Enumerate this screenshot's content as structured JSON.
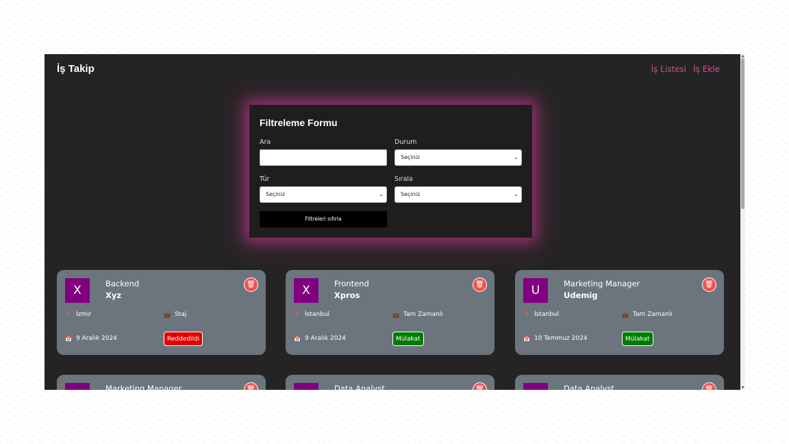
{
  "app": {
    "brand": "İş Takip"
  },
  "nav": {
    "items": [
      {
        "label": "İş Listesi"
      },
      {
        "label": "İş Ekle"
      }
    ]
  },
  "filter": {
    "title": "Filtreleme Formu",
    "search_label": "Ara",
    "search_value": "",
    "status_label": "Durum",
    "status_value": "Seçiniz",
    "type_label": "Tür",
    "type_value": "Seçiniz",
    "sort_label": "Sırala",
    "sort_value": "Seçiniz",
    "reset_label": "Filtreleri sıfırla"
  },
  "jobs": [
    {
      "initial": "X",
      "position": "Backend",
      "company": "Xyz",
      "location": "İzmir",
      "type": "Staj",
      "date": "9 Aralık 2024",
      "status": "Reddedildi",
      "status_color": "#e10000"
    },
    {
      "initial": "X",
      "position": "Frontend",
      "company": "Xpros",
      "location": "İstanbul",
      "type": "Tam Zamanlı",
      "date": "9 Aralık 2024",
      "status": "Mülakat",
      "status_color": "#007a00"
    },
    {
      "initial": "U",
      "position": "Marketing Manager",
      "company": "Udemig",
      "location": "İstanbul",
      "type": "Tam Zamanlı",
      "date": "10 Temmuz 2024",
      "status": "Mülakat",
      "status_color": "#007a00"
    },
    {
      "position": "Marketing Manager"
    },
    {
      "position": "Data Analyst"
    },
    {
      "position": "Data Analyst"
    }
  ],
  "icons": {
    "location": "location-pin-icon",
    "type": "briefcase-icon",
    "date": "calendar-icon",
    "delete": "trash-icon"
  }
}
